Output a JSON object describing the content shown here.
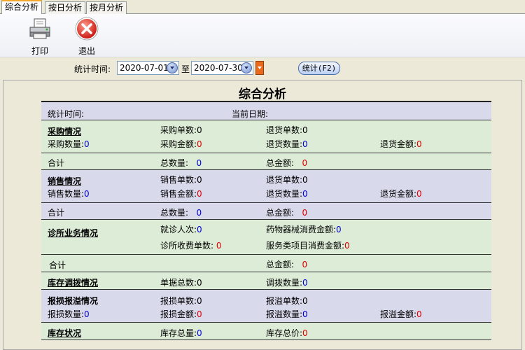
{
  "tabs": [
    {
      "label": "综合分析",
      "active": true
    },
    {
      "label": "按日分析",
      "active": false
    },
    {
      "label": "按月分析",
      "active": false
    }
  ],
  "toolbar": {
    "print_label": "打印",
    "exit_label": "退出"
  },
  "filter": {
    "label": "统计时间:",
    "start_date": "2020-07-01",
    "to_label": "至",
    "end_date": "2020-07-30",
    "stat_button": "统计(F2)"
  },
  "report": {
    "title": "综合分析",
    "header": {
      "period_label": "统计时间:",
      "date_label": "当前日期:"
    },
    "purchase": {
      "heading": "采购情况",
      "orders_label": "采购单数:",
      "orders": "0",
      "return_orders_label": "退货单数:",
      "return_orders": "0",
      "qty_label": "采购数量:",
      "qty": "0",
      "amount_label": "采购金额:",
      "amount": "0",
      "return_qty_label": "退货数量:",
      "return_qty": "0",
      "return_amount_label": "退货金额:",
      "return_amount": "0"
    },
    "purchase_total": {
      "label": "合计",
      "qty_label": "总数量:",
      "qty": "0",
      "amount_label": "总金额:",
      "amount": "0"
    },
    "sales": {
      "heading": "销售情况",
      "orders_label": "销售单数:",
      "orders": "0",
      "return_orders_label": "退货单数:",
      "return_orders": "0",
      "qty_label": "销售数量:",
      "qty": "0",
      "amount_label": "销售金额:",
      "amount": "0",
      "return_qty_label": "退货数量:",
      "return_qty": "0",
      "return_amount_label": "退货金额:",
      "return_amount": "0"
    },
    "sales_total": {
      "label": "合计",
      "qty_label": "总数量:",
      "qty": "0",
      "amount_label": "总金额:",
      "amount": "0"
    },
    "clinic": {
      "heading": "诊所业务情况",
      "visits_label": "就诊人次:",
      "visits": "0",
      "drug_label": "药物器械消费金额:",
      "drug": "0",
      "fee_label": "诊所收费单数:",
      "fee": "0",
      "service_label": "服务类项目消费金额:",
      "service": "0"
    },
    "clinic_total": {
      "label": "合计",
      "amount_label": "总金额:",
      "amount": "0"
    },
    "transfer": {
      "heading": "库存调拨情况",
      "docs_label": "单据总数:",
      "docs": "0",
      "qty_label": "调拨数量:",
      "qty": "0"
    },
    "loss": {
      "heading": "报损报溢情况",
      "loss_orders_label": "报损单数:",
      "loss_orders": "0",
      "gain_orders_label": "报溢单数:",
      "gain_orders": "0",
      "loss_qty_label": "报损数量:",
      "loss_qty": "0",
      "loss_amount_label": "报损金额:",
      "loss_amount": "0",
      "gain_qty_label": "报溢数量:",
      "gain_qty": "0",
      "gain_amount_label": "报溢金额:",
      "gain_amount": "0"
    },
    "stock": {
      "heading": "库存状况",
      "total_qty_label": "库存总量:",
      "total_qty": "0",
      "total_price_label": "库存总价:",
      "total_price": "0"
    }
  }
}
